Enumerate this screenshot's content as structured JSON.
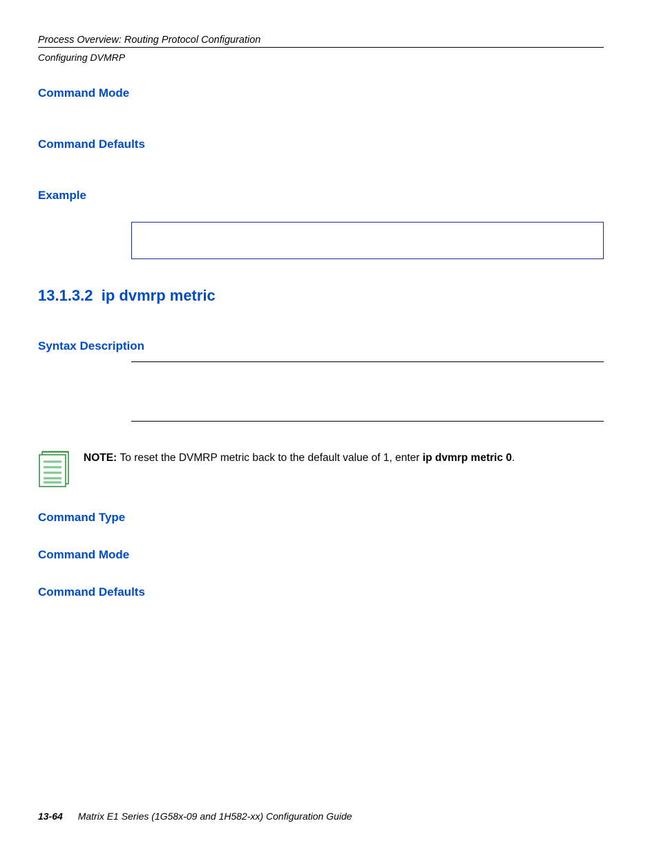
{
  "header": {
    "chapter": "Process Overview: Routing Protocol Configuration",
    "sub": "Configuring DVMRP"
  },
  "headings": {
    "command_mode_1": "Command Mode",
    "command_defaults_1": "Command Defaults",
    "example": "Example",
    "section_number": "13.1.3.2",
    "section_title": "ip dvmrp metric",
    "syntax_description": "Syntax Description",
    "command_type": "Command Type",
    "command_mode_2": "Command Mode",
    "command_defaults_2": "Command Defaults"
  },
  "note": {
    "label": "NOTE:",
    "text_1": "To reset the DVMRP metric back to the default value of 1, enter ",
    "bold_cmd": "ip dvmrp metric 0",
    "text_2": "."
  },
  "footer": {
    "pagenum": "13-64",
    "guide": "Matrix E1 Series (1G58x-09 and 1H582-xx) Configuration Guide"
  }
}
